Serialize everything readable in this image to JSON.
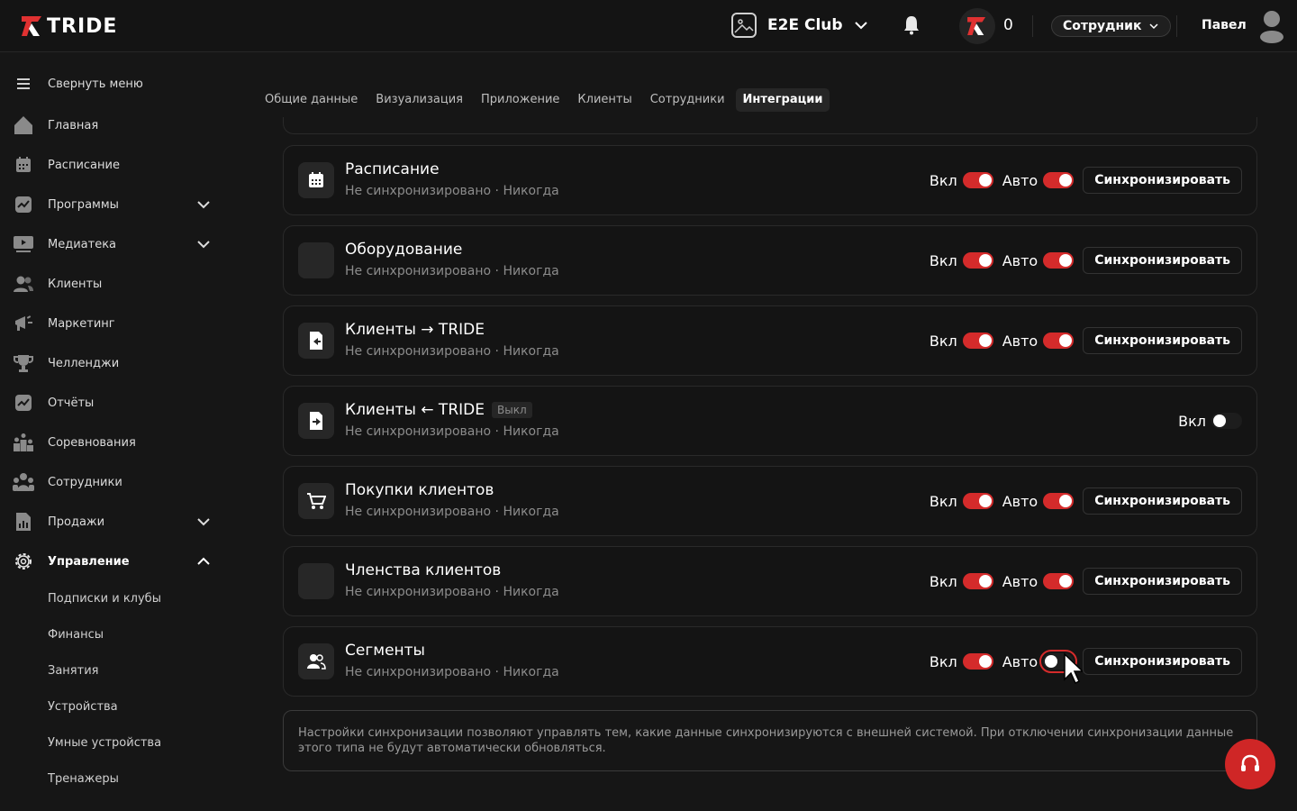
{
  "brand": {
    "name": "TRIDE",
    "accent": "#d42b2b"
  },
  "header": {
    "club_name": "E2E Club",
    "points": "0",
    "role": "Сотрудник",
    "user_name": "Павел"
  },
  "sidebar": {
    "collapse_label": "Свернуть меню",
    "items": [
      {
        "label": "Главная",
        "icon": "home-icon"
      },
      {
        "label": "Расписание",
        "icon": "calendar-icon"
      },
      {
        "label": "Программы",
        "icon": "chart-icon"
      },
      {
        "label": "Медиатека",
        "icon": "media-icon"
      },
      {
        "label": "Клиенты",
        "icon": "users-icon"
      },
      {
        "label": "Маркетинг",
        "icon": "marketing-icon"
      },
      {
        "label": "Челленджи",
        "icon": "trophy-icon"
      },
      {
        "label": "Отчёты",
        "icon": "report-icon"
      },
      {
        "label": "Соревнования",
        "icon": "podium-icon"
      },
      {
        "label": "Сотрудники",
        "icon": "staff-icon"
      },
      {
        "label": "Продажи",
        "icon": "sales-icon"
      },
      {
        "label": "Управление",
        "icon": "gear-icon"
      }
    ],
    "subitems": [
      "Подписки и клубы",
      "Финансы",
      "Занятия",
      "Устройства",
      "Умные устройства",
      "Тренажеры"
    ]
  },
  "tabs": [
    "Общие данные",
    "Визуализация",
    "Приложение",
    "Клиенты",
    "Сотрудники",
    "Интеграции"
  ],
  "active_tab": "Интеграции",
  "labels": {
    "on": "Вкл",
    "auto": "Авто",
    "sync": "Синхронизировать",
    "off_tag": "Выкл",
    "dot": "·"
  },
  "cards": [
    {
      "title": "Расписание",
      "status": "Не синхронизировано",
      "last": "Никогда",
      "icon": "calendar-icon",
      "enabled": true,
      "auto": true
    },
    {
      "title": "Оборудование",
      "status": "Не синхронизировано",
      "last": "Никогда",
      "icon": "blank-icon",
      "enabled": true,
      "auto": true
    },
    {
      "title": "Клиенты → TRIDE",
      "status": "Не синхронизировано",
      "last": "Никогда",
      "icon": "import-icon",
      "enabled": true,
      "auto": true
    },
    {
      "title": "Клиенты ← TRIDE",
      "status": "Не синхронизировано",
      "last": "Никогда",
      "icon": "export-icon",
      "enabled": false,
      "auto": false,
      "tag": "Выкл"
    },
    {
      "title": "Покупки клиентов",
      "status": "Не синхронизировано",
      "last": "Никогда",
      "icon": "cart-icon",
      "enabled": true,
      "auto": true
    },
    {
      "title": "Членства клиентов",
      "status": "Не синхронизировано",
      "last": "Никогда",
      "icon": "blank-icon",
      "enabled": true,
      "auto": true
    },
    {
      "title": "Сегменты",
      "status": "Не синхронизировано",
      "last": "Никогда",
      "icon": "group-icon",
      "enabled": true,
      "auto": false
    }
  ],
  "note": "Настройки синхронизации позволяют управлять тем, какие данные синхронизируются с внешней системой. При отключении синхронизации данные этого типа не будут автоматически обновляться."
}
